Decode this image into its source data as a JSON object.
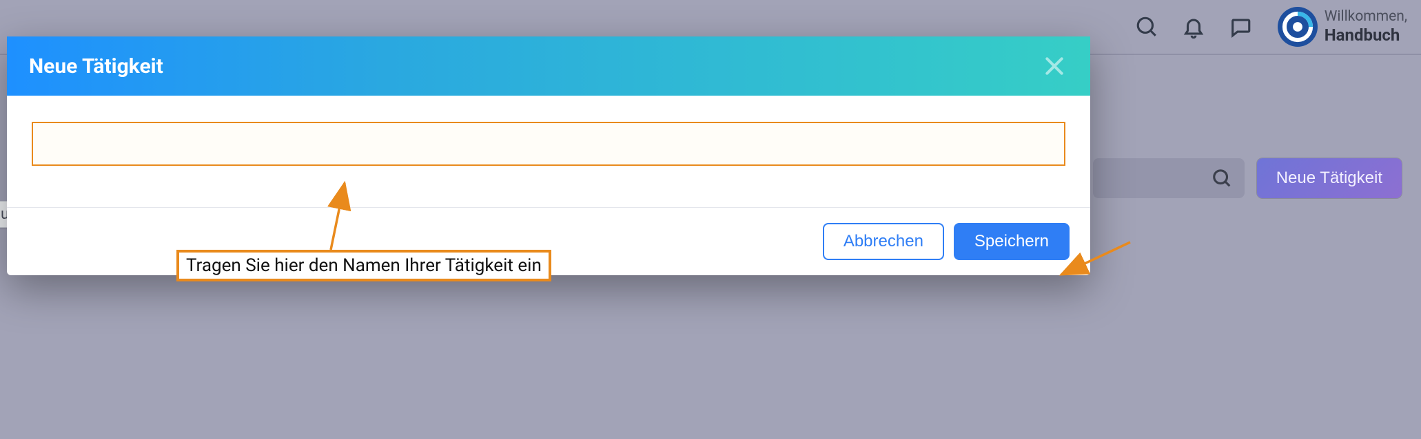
{
  "header": {
    "greeting": "Willkommen,",
    "username": "Handbuch",
    "icons": {
      "search": "search-icon",
      "bell": "bell-icon",
      "chat": "chat-icon"
    }
  },
  "toolbar": {
    "new_activity_label": "Neue Tätigkeit",
    "search_icon": "search-icon"
  },
  "tag_chip": {
    "label_fragment": "ung"
  },
  "dialog": {
    "title": "Neue Tätigkeit",
    "input_value": "",
    "input_placeholder": "",
    "cancel_label": "Abbrechen",
    "save_label": "Speichern"
  },
  "annotations": {
    "input_hint": "Tragen Sie hier den Namen Ihrer Tätigkeit ein"
  },
  "colors": {
    "accent_orange": "#e98a1c",
    "primary_blue": "#2f7ef5",
    "header_gradient_start": "#1e90ff",
    "header_gradient_end": "#36cec6",
    "purple_btn_start": "#6f74d7",
    "purple_btn_end": "#8d6fd2",
    "page_bg": "#a2a3b7"
  }
}
